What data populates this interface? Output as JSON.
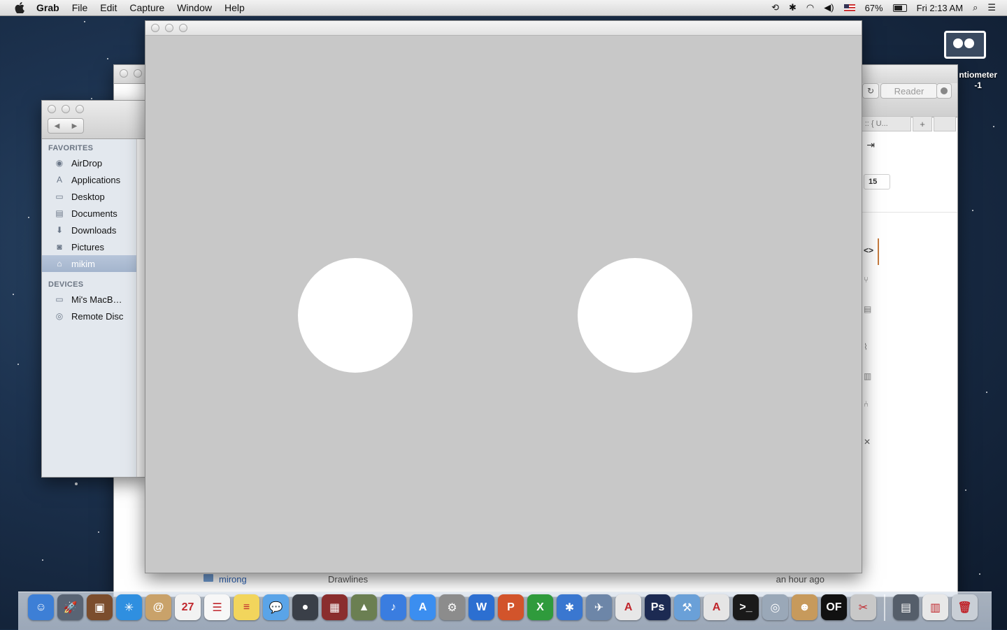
{
  "menubar": {
    "app_name": "Grab",
    "menus": [
      "File",
      "Edit",
      "Capture",
      "Window",
      "Help"
    ],
    "battery": "67%",
    "clock": "Fri 2:13 AM"
  },
  "finder": {
    "favorites_header": "FAVORITES",
    "favorites": [
      {
        "label": "AirDrop",
        "icon": "airdrop-icon"
      },
      {
        "label": "Applications",
        "icon": "applications-icon"
      },
      {
        "label": "Desktop",
        "icon": "desktop-icon"
      },
      {
        "label": "Documents",
        "icon": "documents-icon"
      },
      {
        "label": "Downloads",
        "icon": "downloads-icon"
      },
      {
        "label": "Pictures",
        "icon": "pictures-icon"
      },
      {
        "label": "mikim",
        "icon": "home-icon",
        "selected": true
      }
    ],
    "devices_header": "DEVICES",
    "devices": [
      {
        "label": "Mi's MacB…",
        "icon": "laptop-icon"
      },
      {
        "label": "Remote Disc",
        "icon": "disc-icon"
      }
    ]
  },
  "browser": {
    "reader_label": "Reader",
    "tab_title": ") :: { U...",
    "tab_plus": "+",
    "badge": "15",
    "file_row": {
      "name": "mirong",
      "kind": "Drawlines",
      "modified": "an hour ago"
    }
  },
  "desktop": {
    "label_line1": "ntiometer",
    "label_line2": "-1"
  },
  "dock": {
    "apps": [
      {
        "name": "finder-icon",
        "color": "#3d7fd6",
        "glyph": "☺"
      },
      {
        "name": "launchpad-icon",
        "color": "#596474",
        "glyph": "🚀"
      },
      {
        "name": "photo-booth-icon",
        "color": "#7b4d2d",
        "glyph": "▣"
      },
      {
        "name": "safari-icon",
        "color": "#2f8fe0",
        "glyph": "✳"
      },
      {
        "name": "contacts-icon",
        "color": "#c9a26a",
        "glyph": "@"
      },
      {
        "name": "calendar-icon",
        "color": "#f2f2f2",
        "glyph": "27"
      },
      {
        "name": "reminders-icon",
        "color": "#f7f7f7",
        "glyph": "☰"
      },
      {
        "name": "notes-icon",
        "color": "#f2d55c",
        "glyph": "≡"
      },
      {
        "name": "messages-icon",
        "color": "#5aa4e8",
        "glyph": "💬"
      },
      {
        "name": "facetime-icon",
        "color": "#3a3f48",
        "glyph": "●"
      },
      {
        "name": "photo-viewer-icon",
        "color": "#8a2e2e",
        "glyph": "▦"
      },
      {
        "name": "iphoto-icon",
        "color": "#6b7f52",
        "glyph": "▲"
      },
      {
        "name": "itunes-icon",
        "color": "#3a7de0",
        "glyph": "♪"
      },
      {
        "name": "app-store-icon",
        "color": "#3b8ef0",
        "glyph": "A"
      },
      {
        "name": "system-preferences-icon",
        "color": "#8c8c8c",
        "glyph": "⚙"
      },
      {
        "name": "word-icon",
        "color": "#2c6fd1",
        "glyph": "W"
      },
      {
        "name": "powerpoint-icon",
        "color": "#d2542b",
        "glyph": "P"
      },
      {
        "name": "excel-icon",
        "color": "#2f9b3c",
        "glyph": "X"
      },
      {
        "name": "bluetooth-icon",
        "color": "#3a77d0",
        "glyph": "✱"
      },
      {
        "name": "preview-icon",
        "color": "#6d86a8",
        "glyph": "✈"
      },
      {
        "name": "acrobat-icon",
        "color": "#e7e7e7",
        "glyph": "A"
      },
      {
        "name": "photoshop-icon",
        "color": "#1c2a52",
        "glyph": "Ps"
      },
      {
        "name": "xcode-icon",
        "color": "#6aa0d8",
        "glyph": "⚒"
      },
      {
        "name": "adobe-reader-icon",
        "color": "#e5e5e5",
        "glyph": "A"
      },
      {
        "name": "terminal-icon",
        "color": "#1a1a1a",
        "glyph": ">_"
      },
      {
        "name": "image-capture-icon",
        "color": "#9aa8b8",
        "glyph": "◎"
      },
      {
        "name": "github-icon",
        "color": "#c79a5c",
        "glyph": "☻"
      },
      {
        "name": "processing-icon",
        "color": "#111111",
        "glyph": "OF"
      },
      {
        "name": "grab-icon",
        "color": "#c8c8c8",
        "glyph": "✂"
      }
    ],
    "stacks": [
      {
        "name": "documents-stack-icon",
        "color": "#555e6a",
        "glyph": "▤"
      },
      {
        "name": "downloads-stack-icon",
        "color": "#e8e8e8",
        "glyph": "▥"
      },
      {
        "name": "trash-icon",
        "color": "#c9cfd6",
        "glyph": "🗑"
      }
    ]
  }
}
